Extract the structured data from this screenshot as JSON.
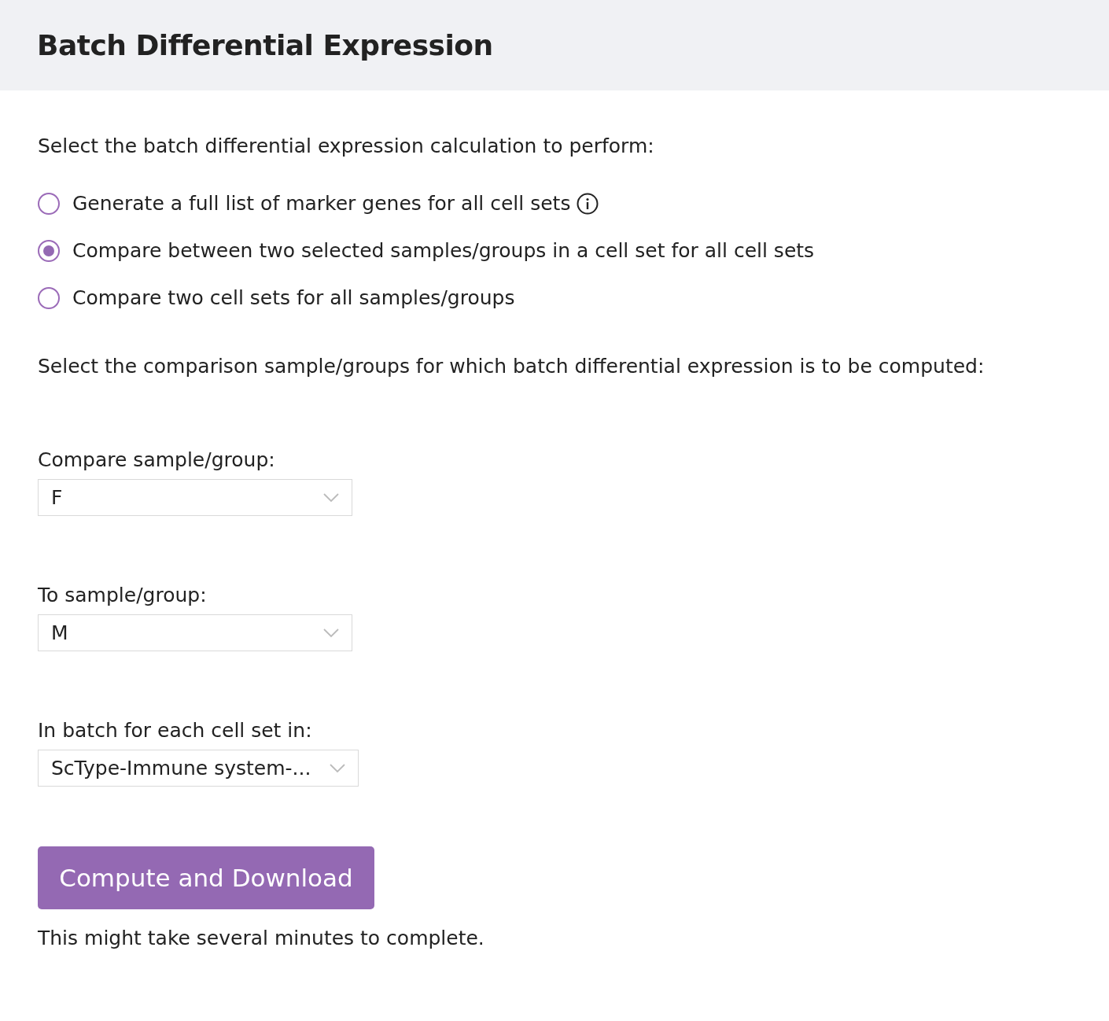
{
  "header": {
    "title": "Batch Differential Expression"
  },
  "intro": "Select the batch differential expression calculation to perform:",
  "options": [
    {
      "label": "Generate a full list of marker genes for all cell sets",
      "selected": false,
      "info": true
    },
    {
      "label": "Compare between two selected samples/groups in a cell set for all cell sets",
      "selected": true,
      "info": false
    },
    {
      "label": "Compare two cell sets for all samples/groups",
      "selected": false,
      "info": false
    }
  ],
  "comparison_prompt": "Select the comparison sample/groups for which batch differential expression is to be computed:",
  "selects": [
    {
      "label": "Compare sample/group:",
      "value": "F"
    },
    {
      "label": "To sample/group:",
      "value": "M"
    },
    {
      "label": "In batch for each cell set in:",
      "value": "ScType-Immune system-..."
    }
  ],
  "button": "Compute and Download",
  "note": "This might take several minutes to complete."
}
